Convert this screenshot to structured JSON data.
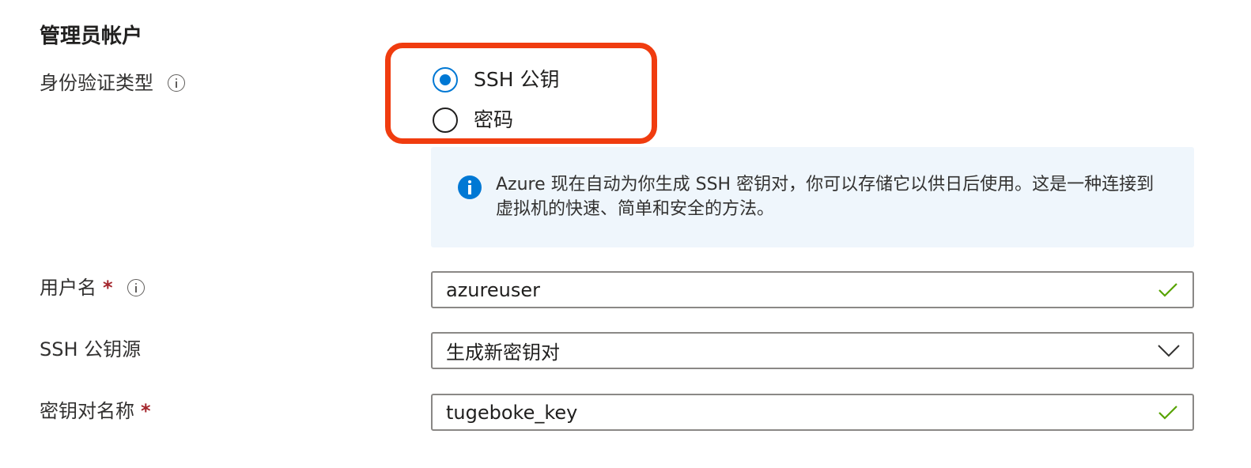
{
  "section": {
    "title": "管理员帐户"
  },
  "auth_type": {
    "label": "身份验证类型",
    "options": [
      {
        "label": "SSH 公钥",
        "selected": true
      },
      {
        "label": "密码",
        "selected": false
      }
    ]
  },
  "info_banner": {
    "icon": "info-icon",
    "text": "Azure 现在自动为你生成 SSH 密钥对，你可以存储它以供日后使用。这是一种连接到虚拟机的快速、简单和安全的方法。"
  },
  "username": {
    "label": "用户名",
    "required_mark": "*",
    "value": "azureuser",
    "valid": true
  },
  "ssh_key_source": {
    "label": "SSH 公钥源",
    "selected": "生成新密钥对"
  },
  "key_pair_name": {
    "label": "密钥对名称",
    "required_mark": "*",
    "value": "tugeboke_key",
    "valid": true
  },
  "colors": {
    "accent": "#0078d4",
    "highlight_border": "#f03c0f",
    "banner_bg": "#eff6fc",
    "required": "#a4262c",
    "valid_check": "#57a300"
  }
}
